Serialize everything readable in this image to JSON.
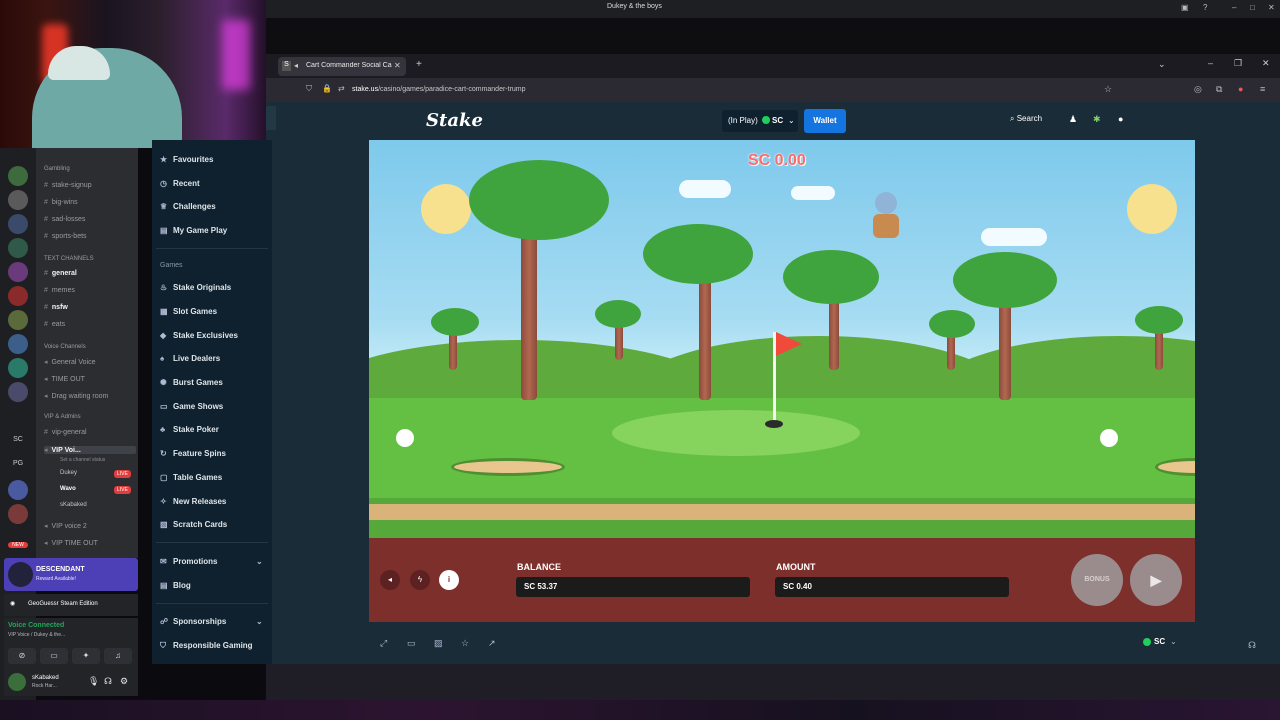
{
  "window": {
    "title": "Dukey & the boys"
  },
  "browser": {
    "tab_title": "Cart Commander Social Ca",
    "url_host": "stake.us",
    "url_path": "/casino/games/paradice-cart-commander-trump"
  },
  "stake_header": {
    "logo": "Stake",
    "in_play": "(In Play)",
    "currency": "SC",
    "wallet": "Wallet",
    "search": "Search"
  },
  "stake_sidebar": {
    "top_items": [
      "Favourites",
      "Recent",
      "Challenges",
      "My Game Play"
    ],
    "section_games": "Games",
    "game_items": [
      "Stake Originals",
      "Slot Games",
      "Stake Exclusives",
      "Live Dealers",
      "Burst Games",
      "Game Shows",
      "Stake Poker",
      "Feature Spins",
      "Table Games",
      "New Releases",
      "Scratch Cards"
    ],
    "bottom_items": [
      "Promotions",
      "Blog",
      "Sponsorships",
      "Responsible Gaming"
    ]
  },
  "game": {
    "win_display": "SC 0.00",
    "balance_label": "BALANCE",
    "balance_value": "SC 53.37",
    "amount_label": "AMOUNT",
    "amount_value": "SC 0.40",
    "bonus_label": "BONUS",
    "footer_currency": "SC"
  },
  "discord": {
    "categories": {
      "gambling": "Gambling",
      "text": "TEXT CHANNELS",
      "voice": "Voice Channels",
      "vip": "VIP & Admins"
    },
    "gambling_channels": [
      "stake-signup",
      "big-wins",
      "sad-losses",
      "sports-bets"
    ],
    "text_channels": [
      "general",
      "memes",
      "nsfw",
      "eats"
    ],
    "voice_channels": [
      "General Voice",
      "TIME OUT",
      "Drag waiting room"
    ],
    "vip_channels": [
      "vip-general",
      "VIP Voi...",
      "VIP voice 2",
      "VIP TIME OUT"
    ],
    "channel_status": "Set a channel status",
    "vip_users": [
      "Dukey",
      "Wavo",
      "sKabaked"
    ],
    "live_badge": "LIVE",
    "servers_text": [
      "SC",
      "PG"
    ],
    "new_badge": "NEW",
    "promo_title": "DESCENDANT",
    "promo_sub": "Reward Available!",
    "activity": "GeoGuessr Steam Edition",
    "voice_connected": "Voice Connected",
    "voice_sub": "VIP Voice / Dukey & the...",
    "username": "sKabaked",
    "user_status": "Rock Har..."
  },
  "colors": {
    "stake_bg": "#1a2c38",
    "wallet_blue": "#1475e1",
    "control_red": "#7d2f2c",
    "win_red": "#ff6b6b"
  }
}
